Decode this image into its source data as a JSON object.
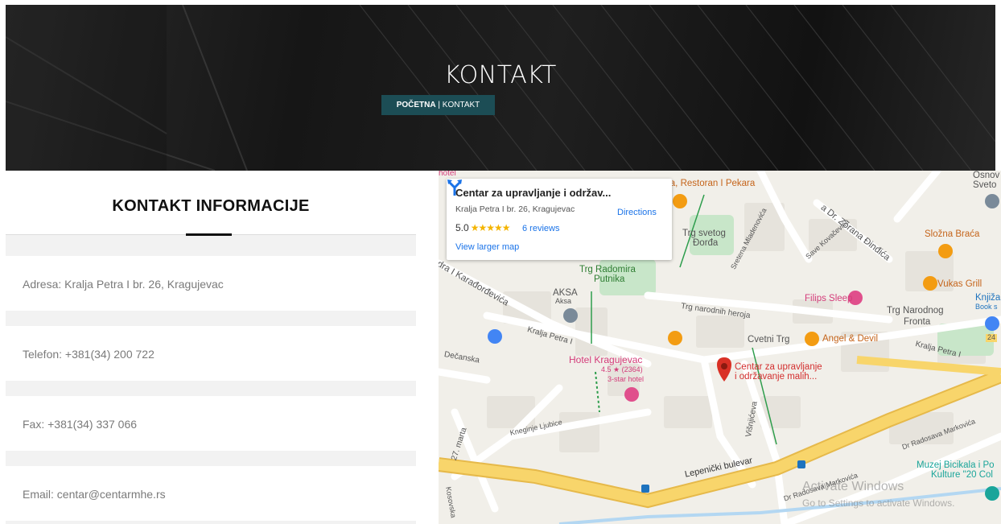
{
  "hero": {
    "title": "KONTAKT",
    "breadcrumb_home": "POČETNA",
    "breadcrumb_sep": "|",
    "breadcrumb_current": "KONTAKT"
  },
  "info": {
    "title": "KONTAKT INFORMACIJE",
    "address": "Adresa: Kralja Petra I br. 26, Kragujevac",
    "phone": "Telefon: +381(34) 200 722",
    "fax": "Fax: +381(34) 337 066",
    "email": "Email: centar@centarmhe.rs"
  },
  "map": {
    "popup": {
      "name": "Centar za upravljanje i održav...",
      "address": "Kralja Petra I br. 26, Kragujevac",
      "rating": "5.0",
      "stars": "★★★★★",
      "reviews": "6 reviews",
      "directions": "Directions",
      "view_larger": "View larger map"
    },
    "labels": {
      "hotel_top": "hotel",
      "restoran": "ega, Restoran I Pekara",
      "zorana": "a Dr. Zorana Đinđića",
      "osnov": "Osnov",
      "svet": "Sveto",
      "trg_svetog": "Trg svetog",
      "dorda": "Đorđa",
      "slozna": "Složna Braća",
      "sretena": "Sretena Mladenovića",
      "save": "Save Kovačevića",
      "kralja_i_kara": "dra I Karađorđevića",
      "trg_radomira": "Trg Radomira",
      "putnika": "Putnika",
      "vukas": "Vukas Grill",
      "knjiz": "Knjiža",
      "book": "Book s",
      "aksa": "AKSA",
      "aksa_sub": "Aksa",
      "filips": "Filips Sleep",
      "trg_narodnih": "Trg narodnih heroja",
      "trg_narodnog": "Trg Narodnog",
      "fronta": "Fronta",
      "kralja_petra": "Kralja Petra I",
      "kralja_petra2": "Kralja Petra I",
      "cvetni": "Cvetni Trg",
      "angel": "Angel & Devil",
      "decanska": "Dečanska",
      "hotel_kragujevac": "Hotel Kragujevac",
      "hotel_rating": "4.5 ★ (2364)",
      "hotel_star": "3-star hotel",
      "centar1": "Centar za upravljanje",
      "centar2": "i održavanje malih...",
      "visnjiceva": "Višnjićeva",
      "marta": "27. marta",
      "kneginje": "Kneginje Ljubice",
      "radosava1": "Dr Radosava Markovića",
      "radosava2": "Dr Radosava Markovića",
      "lepenicki": "Lepenički bulevar",
      "muzej1": "Muzej Bicikala i Po",
      "muzej2": "Kulture \"20 Col",
      "kosovska": "Kosovska",
      "route24": "24"
    },
    "watermark": {
      "line1": "Activate Windows",
      "line2": "Go to Settings to activate Windows."
    }
  },
  "colors": {
    "breadcrumb_bg": "#1c4d55",
    "road_major": "#f5cd57",
    "link_blue": "#1a73e8",
    "pin_red": "#d93025"
  }
}
